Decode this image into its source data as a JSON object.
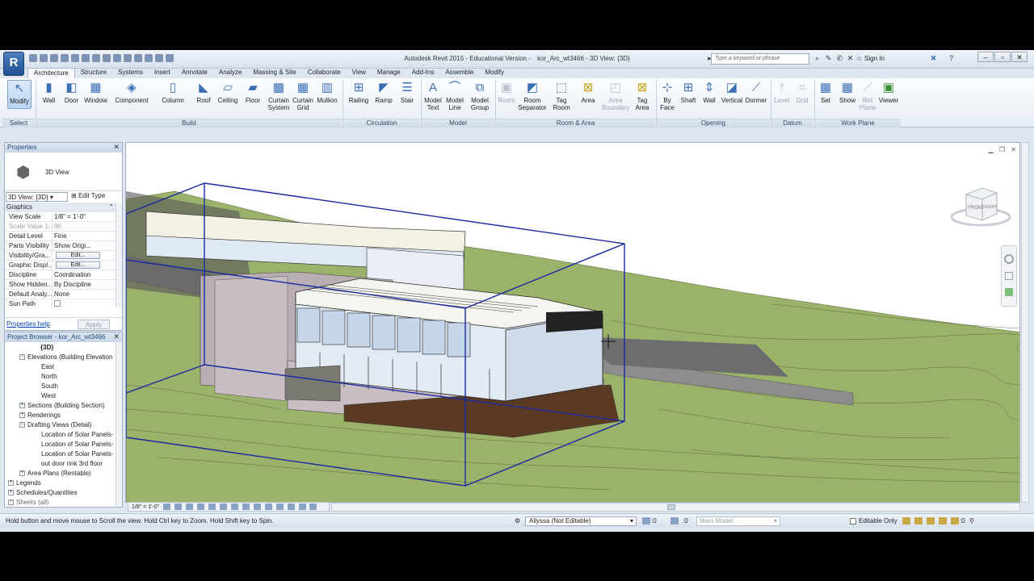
{
  "titlebar": {
    "app_letter": "R",
    "product": "Autodesk Revit 2015 - Educational Version -",
    "file": "kor_Arc_wt3466 - 3D View: {3D}",
    "search_placeholder": "Type a keyword or phrase",
    "sign_in": "Sign In"
  },
  "tabs": [
    "Architecture",
    "Structure",
    "Systems",
    "Insert",
    "Annotate",
    "Analyze",
    "Massing & Site",
    "Collaborate",
    "View",
    "Manage",
    "Add-Ins",
    "Assemble",
    "Modify"
  ],
  "ribbon": {
    "select": {
      "modify": "Modify",
      "label": "Select"
    },
    "build": {
      "label": "Build",
      "wall": "Wall",
      "door": "Door",
      "window": "Window",
      "component": "Component",
      "column": "Column",
      "roof": "Roof",
      "ceiling": "Ceiling",
      "floor": "Floor",
      "curtain_system_1": "Curtain",
      "curtain_system_2": "System",
      "curtain_grid_1": "Curtain",
      "curtain_grid_2": "Grid",
      "mullion": "Mullion"
    },
    "circulation": {
      "label": "Circulation",
      "railing": "Railing",
      "ramp": "Ramp",
      "stair": "Stair"
    },
    "model": {
      "label": "Model",
      "model_text_1": "Model",
      "model_text_2": "Text",
      "model_line_1": "Model",
      "model_line_2": "Line",
      "model_group_1": "Model",
      "model_group_2": "Group"
    },
    "room_area": {
      "label": "Room & Area",
      "room": "Room",
      "room_sep_1": "Room",
      "room_sep_2": "Separator",
      "tag_room_1": "Tag",
      "tag_room_2": "Room",
      "area": "Area",
      "area_boundary_1": "Area",
      "area_boundary_2": "Boundary",
      "tag_area_1": "Tag",
      "tag_area_2": "Area"
    },
    "opening": {
      "label": "Opening",
      "by_face_1": "By",
      "by_face_2": "Face",
      "shaft": "Shaft",
      "wall": "Wall",
      "vertical": "Vertical",
      "dormer": "Dormer"
    },
    "datum": {
      "label": "Datum",
      "level": "Level",
      "grid": "Grid"
    },
    "work_plane": {
      "label": "Work Plane",
      "set": "Set",
      "show": "Show",
      "ref_plane_1": "Ref",
      "ref_plane_2": "Plane",
      "viewer": "Viewer"
    }
  },
  "properties": {
    "title": "Properties",
    "type_name": "3D View",
    "view_selector": "3D View: {3D}",
    "edit_type": "Edit Type",
    "section": "Graphics",
    "rows": [
      {
        "k": "View Scale",
        "v": "1/8\" = 1'-0\""
      },
      {
        "k": "Scale Value   1:",
        "v": "96"
      },
      {
        "k": "Detail Level",
        "v": "Fine"
      },
      {
        "k": "Parts Visibility",
        "v": "Show Origi..."
      },
      {
        "k": "Visibility/Gra...",
        "v": "Edit..."
      },
      {
        "k": "Graphic Displ...",
        "v": "Edit..."
      },
      {
        "k": "Discipline",
        "v": "Coordination"
      },
      {
        "k": "Show Hidden...",
        "v": "By Discipline"
      },
      {
        "k": "Default Analy...",
        "v": "None"
      },
      {
        "k": "Sun Path",
        "v": ""
      }
    ],
    "help": "Properties help",
    "apply": "Apply"
  },
  "browser": {
    "title": "Project Browser - kor_Arc_wt3466",
    "items": [
      "{3D}",
      "Elevations (Building Elevation",
      "East",
      "North",
      "South",
      "West",
      "Sections (Building Section)",
      "Renderings",
      "Drafting Views (Detail)",
      "Location of Solar Panels-",
      "Location of Solar Panels-",
      "Location of Solar Panels-",
      "out door rink 3rd floor",
      "Area Plans (Rentable)",
      "Legends",
      "Schedules/Quantities",
      "Sheets (all)"
    ]
  },
  "viewcube": {
    "front": "FRONT",
    "right": "RIGHT"
  },
  "viewbar": {
    "scale": "1/8\" = 1'-0\""
  },
  "status": {
    "message": "Hold button and move mouse to Scroll the view. Hold Ctrl key to Zoom. Hold Shift key to Spin.",
    "workset": "Allyssa (Not Editable)",
    "count1": ":0",
    "count2": ":0",
    "design_option": "Main Model",
    "editable_only": "Editable Only",
    "count3": ":0"
  }
}
